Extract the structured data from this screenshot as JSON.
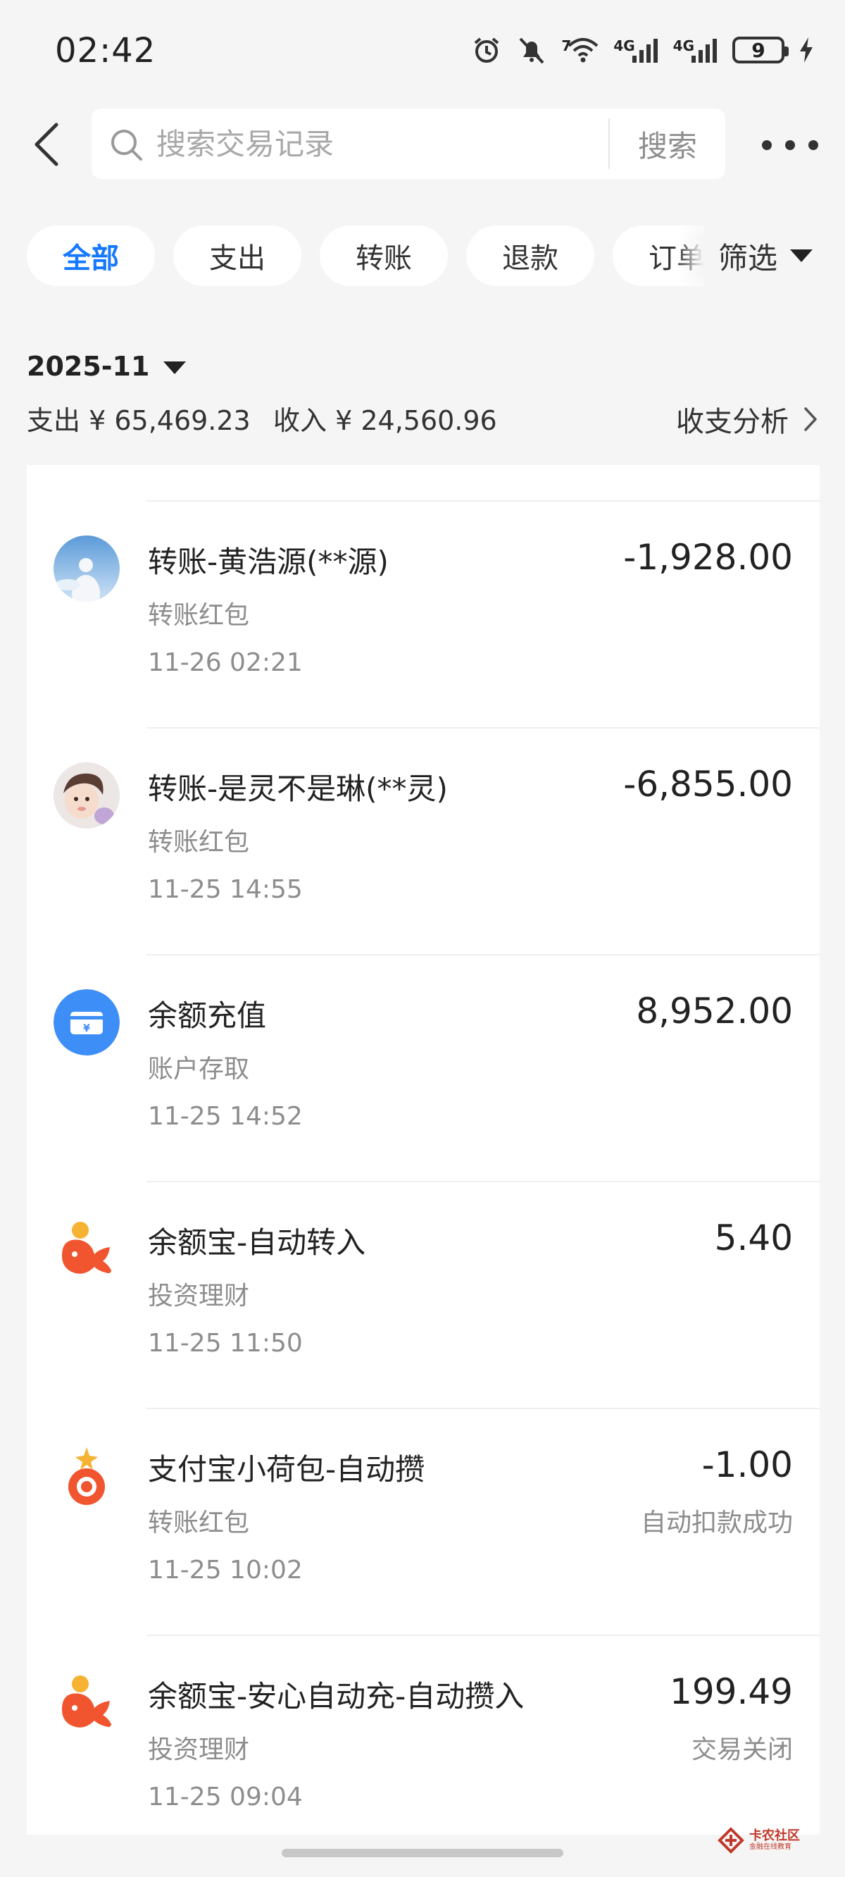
{
  "status_bar": {
    "time": "02:42",
    "icons": [
      "alarm-icon",
      "mute-icon",
      "wifi-icon",
      "signal-4g-icon",
      "signal-4g-icon",
      "battery-icon",
      "charging-icon"
    ],
    "wifi_badge": "7",
    "net1": "4G",
    "net2": "4G",
    "battery": "9"
  },
  "header": {
    "back_icon": "chevron-left-icon",
    "search_placeholder": "搜索交易记录",
    "search_button": "搜索",
    "more_icon": "more-dots-icon"
  },
  "filters": {
    "tabs": [
      {
        "label": "全部",
        "active": true
      },
      {
        "label": "支出",
        "active": false
      },
      {
        "label": "转账",
        "active": false
      },
      {
        "label": "退款",
        "active": false
      },
      {
        "label": "订单",
        "active": false
      }
    ],
    "filter_label": "筛选"
  },
  "summary": {
    "month": "2025-11",
    "expense": "支出 ¥ 65,469.23",
    "income": "收入 ¥ 24,560.96",
    "analysis": "收支分析"
  },
  "transactions": [
    {
      "title": "转账-黄浩源(**源)",
      "category": "转账红包",
      "time": "11-26 02:21",
      "amount": "-1,928.00",
      "status": "",
      "avatar": "photo-avatar"
    },
    {
      "title": "转账-是灵不是琳(**灵)",
      "category": "转账红包",
      "time": "11-25 14:55",
      "amount": "-6,855.00",
      "status": "",
      "avatar": "photo-avatar"
    },
    {
      "title": "余额充值",
      "category": "账户存取",
      "time": "11-25 14:52",
      "amount": "8,952.00",
      "status": "",
      "avatar": "balance-card-icon"
    },
    {
      "title": "余额宝-自动转入",
      "category": "投资理财",
      "time": "11-25 11:50",
      "amount": "5.40",
      "status": "",
      "avatar": "yuebao-icon"
    },
    {
      "title": "支付宝小荷包-自动攒",
      "category": "转账红包",
      "time": "11-25 10:02",
      "amount": "-1.00",
      "status": "自动扣款成功",
      "avatar": "xiaohebao-icon"
    },
    {
      "title": "余额宝-安心自动充-自动攒入",
      "category": "投资理财",
      "time": "11-25 09:04",
      "amount": "199.49",
      "status": "交易关闭",
      "avatar": "yuebao-icon"
    }
  ],
  "watermark": {
    "main": "卡农社区",
    "sub": "金融在线教育"
  },
  "colors": {
    "accent": "#1677ff",
    "background": "#f5f5f5",
    "card": "#ffffff",
    "yuebao": "#f0552f",
    "balance": "#3e8ef7"
  }
}
